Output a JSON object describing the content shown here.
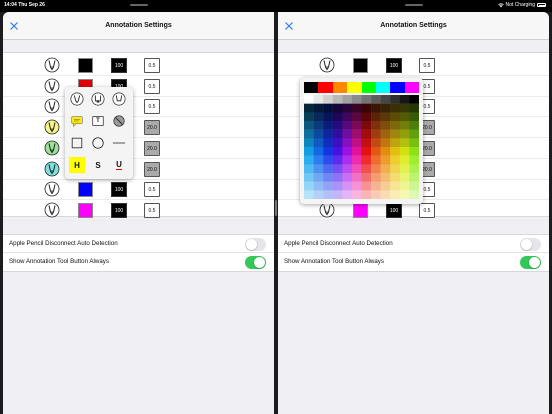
{
  "status": {
    "time": "14:04",
    "date": "Thu Sep 26",
    "charging": "Not Charging"
  },
  "nav": {
    "title": "Annotation Settings",
    "close_label": "✕"
  },
  "tools": [
    {
      "color": "#000000",
      "opacity": "100",
      "width": "0.5",
      "pen_color": "#ffffff"
    },
    {
      "color": "#e00000",
      "opacity": "100",
      "width": "0.5",
      "pen_color": "#ffffff"
    },
    {
      "color": "#ffffff",
      "opacity": "100",
      "width": "0.5",
      "pen_color": "#ffffff"
    },
    {
      "color": "#ffff00",
      "opacity": "20",
      "width": "20.0",
      "pen_color": "#f5f58a"
    },
    {
      "color": "#00cc00",
      "opacity": "20",
      "width": "20.0",
      "pen_color": "#9be39b"
    },
    {
      "color": "#00cccc",
      "opacity": "20",
      "width": "20.0",
      "pen_color": "#7fe0e0"
    },
    {
      "color": "#0000ff",
      "opacity": "100",
      "width": "0.5",
      "pen_color": "#ffffff"
    },
    {
      "color": "#ff00ff",
      "opacity": "100",
      "width": "0.5",
      "pen_color": "#ffffff"
    }
  ],
  "settings": [
    {
      "label": "Apple Pencil Disconnect Auto Detection",
      "on": false
    },
    {
      "label": "Show Annotation Tool Button Always",
      "on": true
    }
  ],
  "tool_picker": {
    "text_tool": "T",
    "highlight": "H",
    "strike": "S",
    "underline": "U"
  },
  "color_picker": {
    "primaries": [
      "#000000",
      "#ff0000",
      "#ff8800",
      "#ffff00",
      "#00ff00",
      "#00ffff",
      "#0000ff",
      "#ff00ff"
    ]
  },
  "icons": {
    "close": "close-icon",
    "pen": "pen-icon",
    "wifi": "wifi-icon",
    "battery": "battery-icon"
  }
}
